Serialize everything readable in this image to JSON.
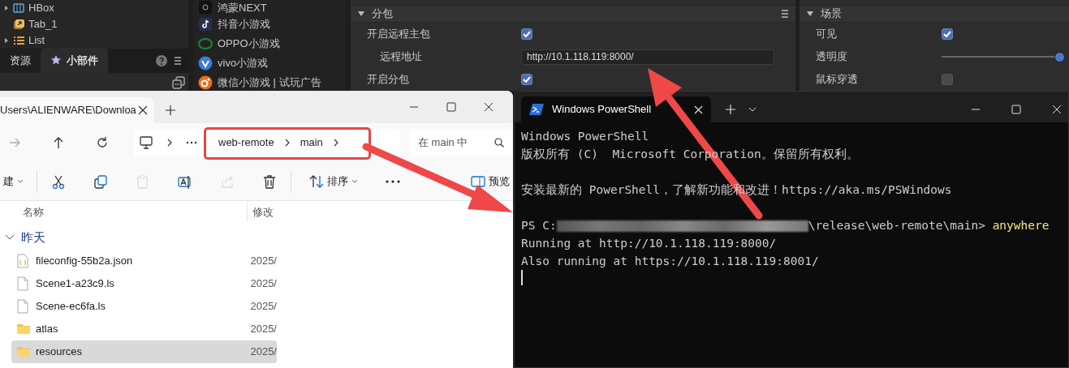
{
  "editor": {
    "hierarchy": [
      {
        "label": "HBox",
        "kind": "hbox",
        "expandable": true
      },
      {
        "label": "Tab_1",
        "kind": "tab",
        "expandable": false
      },
      {
        "label": "List",
        "kind": "list",
        "expandable": true
      }
    ],
    "panel_tabs": [
      {
        "label": "资源",
        "selected": false
      },
      {
        "label": "小部件",
        "selected": true
      }
    ],
    "platforms": [
      {
        "label": "鸿蒙NEXT",
        "kind": "harmony"
      },
      {
        "label": "抖音小游戏",
        "kind": "douyin"
      },
      {
        "label": "OPPO小游戏",
        "kind": "oppo"
      },
      {
        "label": "vivo小游戏",
        "kind": "vivo"
      },
      {
        "label": "微信小游戏 | 试玩广告",
        "kind": "wechat"
      }
    ],
    "subpackage": {
      "title": "分包",
      "expanded": true,
      "rows": [
        {
          "kind": "checkbox",
          "label": "开启远程主包",
          "checked": true
        },
        {
          "kind": "field",
          "label": "远程地址",
          "value": "http://10.1.118.119:8000/"
        },
        {
          "kind": "checkbox",
          "label": "开启分包",
          "checked": true
        }
      ]
    },
    "scene": {
      "title": "场景",
      "expanded": true,
      "rows": [
        {
          "kind": "checkbox",
          "label": "可见",
          "checked": true
        },
        {
          "kind": "slider",
          "label": "透明度",
          "level": 1
        },
        {
          "kind": "checkbox",
          "label": "鼠标穿透",
          "checked": false
        }
      ]
    }
  },
  "explorer": {
    "tab_title": "Users\\ALIENWARE\\Downloa",
    "nav": [
      {
        "kind": "forward",
        "disabled": true
      },
      {
        "kind": "up",
        "disabled": false
      },
      {
        "kind": "refresh",
        "disabled": false
      }
    ],
    "breadcrumb": [
      "web-remote",
      "main"
    ],
    "search": {
      "placeholder": "在 main 中"
    },
    "toolbar": [
      {
        "kind": "new",
        "label": "建",
        "disabled": false
      },
      {
        "kind": "cut",
        "disabled": false
      },
      {
        "kind": "copy",
        "disabled": false
      },
      {
        "kind": "paste",
        "disabled": true
      },
      {
        "kind": "rename",
        "disabled": false
      },
      {
        "kind": "share",
        "disabled": true
      },
      {
        "kind": "delete",
        "disabled": false
      },
      {
        "kind": "sort",
        "label": "排序",
        "disabled": false
      },
      {
        "kind": "more",
        "disabled": false
      },
      {
        "kind": "preview",
        "label": "预览",
        "disabled": false
      }
    ],
    "columns": [
      "名称",
      "修改"
    ],
    "group": {
      "label": "昨天",
      "expanded": true
    },
    "files": [
      {
        "name": "fileconfig-55b2a.json",
        "kind": "json",
        "date": "2025/",
        "selected": false
      },
      {
        "name": "Scene1-a23c9.ls",
        "kind": "file",
        "date": "2025/",
        "selected": false
      },
      {
        "name": "Scene-ec6fa.ls",
        "kind": "file",
        "date": "2025/",
        "selected": false
      },
      {
        "name": "atlas",
        "kind": "folder",
        "date": "2025/",
        "selected": false
      },
      {
        "name": "resources",
        "kind": "folder",
        "date": "2025/",
        "selected": true
      }
    ]
  },
  "terminal": {
    "tab_title": "Windows PowerShell",
    "lines": [
      {
        "kind": "text",
        "text": "Windows PowerShell"
      },
      {
        "kind": "text",
        "text": "版权所有 (C)  Microsoft Corporation。保留所有权利。"
      },
      {
        "kind": "blank"
      },
      {
        "kind": "text",
        "text": "安装最新的 PowerShell，了解新功能和改进！https://aka.ms/PSWindows"
      },
      {
        "kind": "blank"
      },
      {
        "kind": "prompt",
        "prefix": "PS C:",
        "path": "\\release\\web-remote\\main> ",
        "command": "anywhere"
      },
      {
        "kind": "text",
        "text": "Running at http://10.1.118.119:8000/"
      },
      {
        "kind": "text",
        "text": "Also running at https://10.1.118.119:8001/"
      },
      {
        "kind": "cursor"
      }
    ]
  }
}
